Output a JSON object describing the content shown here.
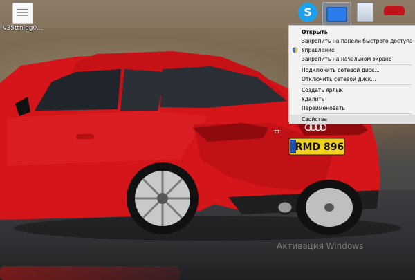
{
  "desktop": {
    "icons": [
      {
        "label": "v35ttnieg0...",
        "icon": "document-icon"
      },
      {
        "label": "",
        "icon": "skype-icon"
      },
      {
        "label": "",
        "icon": "this-pc-icon"
      },
      {
        "label": "",
        "icon": "recycle-bin-icon"
      },
      {
        "label": "",
        "icon": "car-app-icon"
      }
    ]
  },
  "car": {
    "plate_text": "RMD 896",
    "badge_text": "TT"
  },
  "context_menu": {
    "items": [
      {
        "label": "Открыть",
        "bold": true
      },
      {
        "label": "Закрепить на панели быстрого доступа"
      },
      {
        "label": "Управление",
        "icon": "shield-icon"
      },
      {
        "label": "Закрепить на начальном экране"
      },
      {
        "label": "Подключить сетевой диск..."
      },
      {
        "label": "Отключить сетевой диск..."
      },
      {
        "label": "Создать ярлык"
      },
      {
        "label": "Удалить"
      },
      {
        "label": "Переименовать"
      },
      {
        "label": "Свойства",
        "hover": true
      }
    ]
  },
  "watermark": "Активация Windows",
  "colors": {
    "car_red": "#d4151a",
    "plate_yellow": "#f0d21a",
    "menu_bg": "#f2f2f2"
  }
}
